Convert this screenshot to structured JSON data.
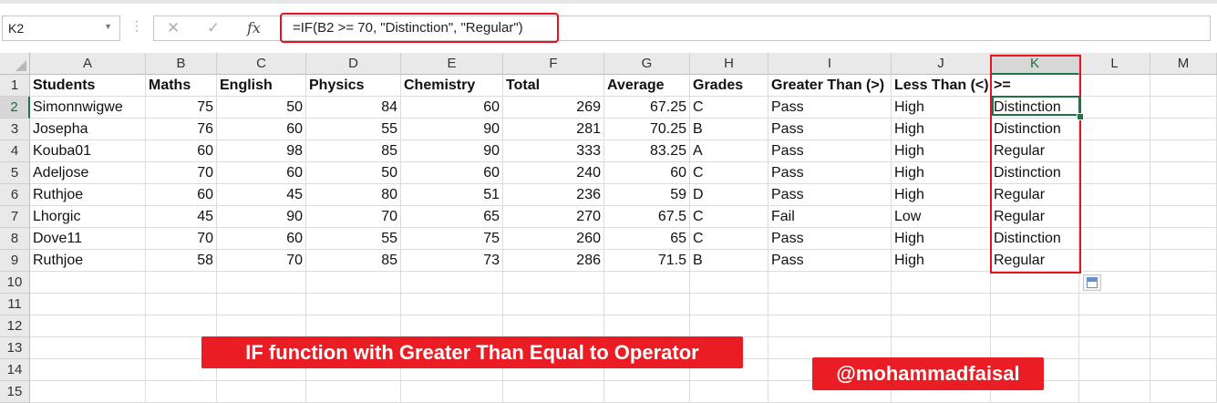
{
  "formula_bar": {
    "name_box": "K2",
    "cancel_glyph": "✕",
    "enter_glyph": "✓",
    "fx_label": "fx",
    "formula": "=IF(B2 >= 70, \"Distinction\", \"Regular\")"
  },
  "sheet": {
    "columns": [
      "A",
      "B",
      "C",
      "D",
      "E",
      "F",
      "G",
      "H",
      "I",
      "J",
      "K",
      "L",
      "M"
    ],
    "row_numbers": [
      "1",
      "2",
      "3",
      "4",
      "5",
      "6",
      "7",
      "8",
      "9",
      "10",
      "11",
      "12",
      "13",
      "14",
      "15"
    ],
    "header_row": [
      "Students",
      "Maths",
      "English",
      "Physics",
      "Chemistry",
      "Total",
      "Average",
      "Grades",
      "Greater Than (>)",
      "Less Than (<)",
      ">="
    ],
    "rows": [
      [
        "Simonnwigwe",
        "75",
        "50",
        "84",
        "60",
        "269",
        "67.25",
        "C",
        "Pass",
        "High",
        "Distinction"
      ],
      [
        "Josepha",
        "76",
        "60",
        "55",
        "90",
        "281",
        "70.25",
        "B",
        "Pass",
        "High",
        "Distinction"
      ],
      [
        "Kouba01",
        "60",
        "98",
        "85",
        "90",
        "333",
        "83.25",
        "A",
        "Pass",
        "High",
        "Regular"
      ],
      [
        "Adeljose",
        "70",
        "60",
        "50",
        "60",
        "240",
        "60",
        "C",
        "Pass",
        "High",
        "Distinction"
      ],
      [
        "Ruthjoe",
        "60",
        "45",
        "80",
        "51",
        "236",
        "59",
        "D",
        "Pass",
        "High",
        "Regular"
      ],
      [
        "Lhorgic",
        "45",
        "90",
        "70",
        "65",
        "270",
        "67.5",
        "C",
        "Fail",
        "Low",
        "Regular"
      ],
      [
        "Dove11",
        "70",
        "60",
        "55",
        "75",
        "260",
        "65",
        "C",
        "Pass",
        "High",
        "Distinction"
      ],
      [
        "Ruthjoe",
        "58",
        "70",
        "85",
        "73",
        "286",
        "71.5",
        "B",
        "Pass",
        "High",
        "Regular"
      ]
    ],
    "active_cell": "K2"
  },
  "overlays": {
    "title_banner": "IF function with Greater Than Equal to Operator",
    "handle_banner": "@mohammadfaisal"
  },
  "colors": {
    "highlight_red": "#e8121e",
    "excel_green": "#217346",
    "banner_red": "#ea1c24"
  },
  "icons": {
    "cancel": "close-icon",
    "enter": "checkmark-icon",
    "function": "fx-icon",
    "quick_analysis": "quick-analysis-icon"
  }
}
